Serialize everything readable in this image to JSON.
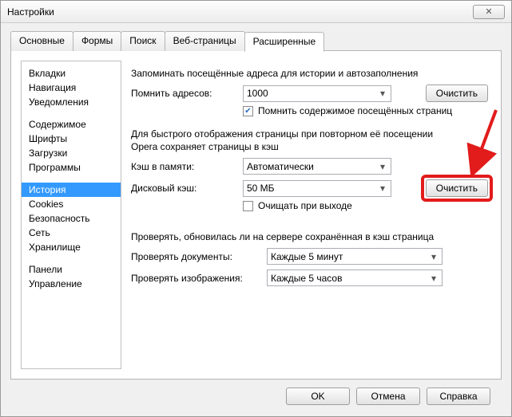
{
  "window": {
    "title": "Настройки"
  },
  "tabs": [
    {
      "label": "Основные"
    },
    {
      "label": "Формы"
    },
    {
      "label": "Поиск"
    },
    {
      "label": "Веб-страницы"
    },
    {
      "label": "Расширенные",
      "active": true
    }
  ],
  "sidebar": {
    "items": [
      {
        "label": "Вкладки"
      },
      {
        "label": "Навигация"
      },
      {
        "label": "Уведомления"
      },
      {
        "label": "Содержимое",
        "gap": true
      },
      {
        "label": "Шрифты"
      },
      {
        "label": "Загрузки"
      },
      {
        "label": "Программы"
      },
      {
        "label": "История",
        "gap": true,
        "selected": true
      },
      {
        "label": "Cookies"
      },
      {
        "label": "Безопасность"
      },
      {
        "label": "Сеть"
      },
      {
        "label": "Хранилище"
      },
      {
        "label": "Панели",
        "gap": true
      },
      {
        "label": "Управление"
      }
    ]
  },
  "history": {
    "intro": "Запоминать посещённые адреса для истории и автозаполнения",
    "remember_label": "Помнить адресов:",
    "remember_value": "1000",
    "clear1": "Очистить",
    "remember_pages_check": "Помнить содержимое посещённых страниц",
    "cache_intro1": "Для быстрого отображения страницы при повторном её посещении",
    "cache_intro2": "Opera сохраняет страницы в кэш",
    "mem_cache_label": "Кэш в памяти:",
    "mem_cache_value": "Автоматически",
    "disk_cache_label": "Дисковый кэш:",
    "disk_cache_value": "50 МБ",
    "clear2": "Очистить",
    "clear_on_exit": "Очищать при выходе",
    "verify_intro": "Проверять, обновилась ли на сервере сохранённая в кэш страница",
    "verify_docs_label": "Проверять документы:",
    "verify_docs_value": "Каждые 5 минут",
    "verify_imgs_label": "Проверять изображения:",
    "verify_imgs_value": "Каждые 5 часов"
  },
  "footer": {
    "ok": "OK",
    "cancel": "Отмена",
    "help": "Справка"
  }
}
